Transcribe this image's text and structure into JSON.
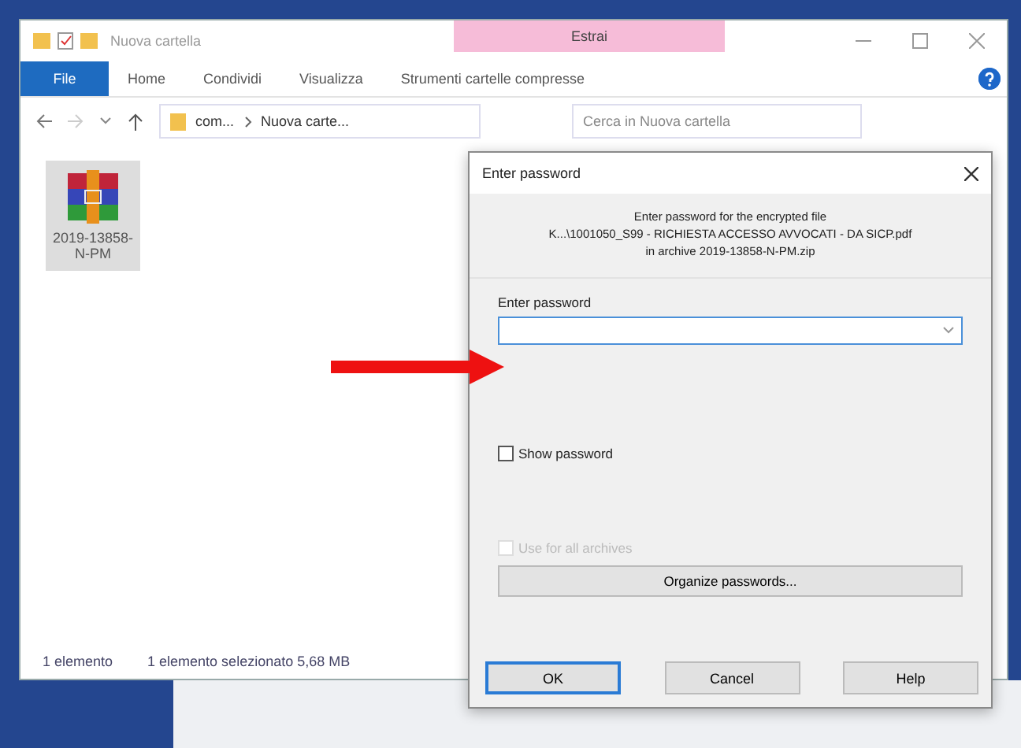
{
  "explorer": {
    "title": "Nuova cartella",
    "context_tab": "Estrai",
    "file_tab": "File",
    "ribbon_tabs": [
      {
        "label": "Home",
        "selected": false
      },
      {
        "label": "Condividi",
        "selected": false
      },
      {
        "label": "Visualizza",
        "selected": false
      },
      {
        "label": "Strumenti cartelle compresse",
        "selected": false
      }
    ],
    "path": [
      "com...",
      "Nuova carte..."
    ],
    "search": {
      "placeholder": "Cerca in Nuova cartella"
    },
    "files": [
      {
        "name": "2019-13858-N-PM",
        "selected": true
      }
    ],
    "status": [
      "1 elemento",
      "1 elemento selezionato  5,68 MB"
    ]
  },
  "dialog": {
    "title": "Enter password",
    "message": [
      "Enter password for the encrypted file",
      "K...\\1001050_S99 - RICHIESTA ACCESSO AVVOCATI - DA SICP.pdf",
      "in archive 2019-13858-N-PM.zip"
    ],
    "field_label": "Enter password",
    "options": [
      {
        "label": "Show password",
        "checked": false,
        "disabled": false
      },
      {
        "label": "Use for all archives",
        "checked": false,
        "disabled": true
      }
    ],
    "organize_button": "Organize passwords...",
    "buttons": [
      {
        "label": "OK",
        "default": true
      },
      {
        "label": "Cancel",
        "default": false
      },
      {
        "label": "Help",
        "default": false
      }
    ]
  }
}
